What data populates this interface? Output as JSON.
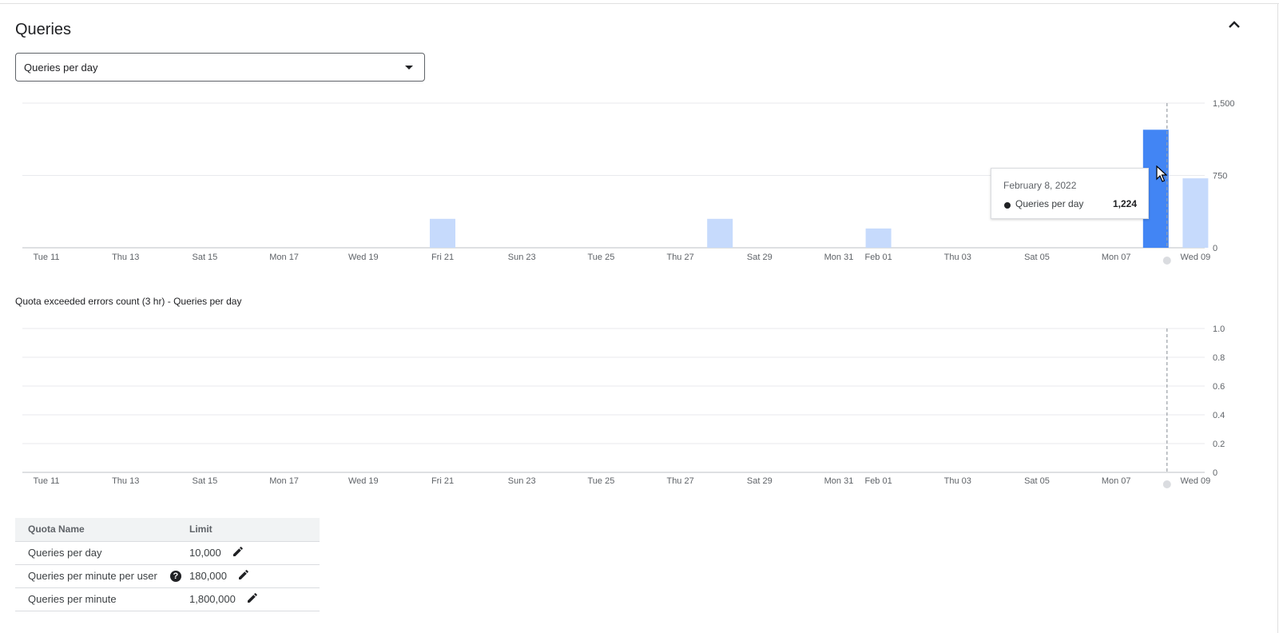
{
  "section": {
    "title": "Queries",
    "collapse_icon": "chevron-up-icon"
  },
  "selector": {
    "value": "Queries per day",
    "icon": "dropdown-arrow-icon"
  },
  "colors": {
    "bar": "#c6dafc",
    "bar_highlight": "#4285f4",
    "grid": "#e8eaed",
    "crosshair": "#9aa0a6"
  },
  "chart_data": [
    {
      "type": "bar",
      "title": "",
      "x_ticks": [
        "Tue 11",
        "Thu 13",
        "Sat 15",
        "Mon 17",
        "Wed 19",
        "Fri 21",
        "Sun 23",
        "Tue 25",
        "Thu 27",
        "Sat 29",
        "Mon 31",
        "Feb 01",
        "Thu 03",
        "Sat 05",
        "Mon 07",
        "Wed 09"
      ],
      "y_ticks": [
        "1,500",
        "750",
        "0"
      ],
      "ylim": [
        0,
        1500
      ],
      "y_axis_side": "right",
      "bars": [
        {
          "date": "2022-01-21",
          "value": 300
        },
        {
          "date": "2022-01-28",
          "value": 300
        },
        {
          "date": "2022-02-01",
          "value": 200
        },
        {
          "date": "2022-02-08",
          "value": 1224,
          "highlighted": true
        },
        {
          "date": "2022-02-09",
          "value": 720
        }
      ],
      "series": [
        {
          "name": "Queries per day"
        }
      ],
      "grid": true,
      "crosshair_date": "2022-02-08",
      "tooltip": {
        "date": "February 8, 2022",
        "series": "Queries per day",
        "value": "1,224"
      }
    },
    {
      "type": "line",
      "title": "Quota exceeded errors count (3 hr) - Queries per day",
      "x_ticks": [
        "Tue 11",
        "Thu 13",
        "Sat 15",
        "Mon 17",
        "Wed 19",
        "Fri 21",
        "Sun 23",
        "Tue 25",
        "Thu 27",
        "Sat 29",
        "Mon 31",
        "Feb 01",
        "Thu 03",
        "Sat 05",
        "Mon 07",
        "Wed 09"
      ],
      "y_ticks": [
        "1.0",
        "0.8",
        "0.6",
        "0.4",
        "0.2",
        "0"
      ],
      "ylim": [
        0,
        1.0
      ],
      "y_axis_side": "right",
      "series": [],
      "grid": true,
      "crosshair_date": "2022-02-08"
    }
  ],
  "table": {
    "headers": [
      "Quota Name",
      "Limit"
    ],
    "rows": [
      {
        "name": "Queries per day",
        "limit": "10,000",
        "help": false
      },
      {
        "name": "Queries per minute per user",
        "limit": "180,000",
        "help": true
      },
      {
        "name": "Queries per minute",
        "limit": "1,800,000",
        "help": false
      }
    ]
  }
}
